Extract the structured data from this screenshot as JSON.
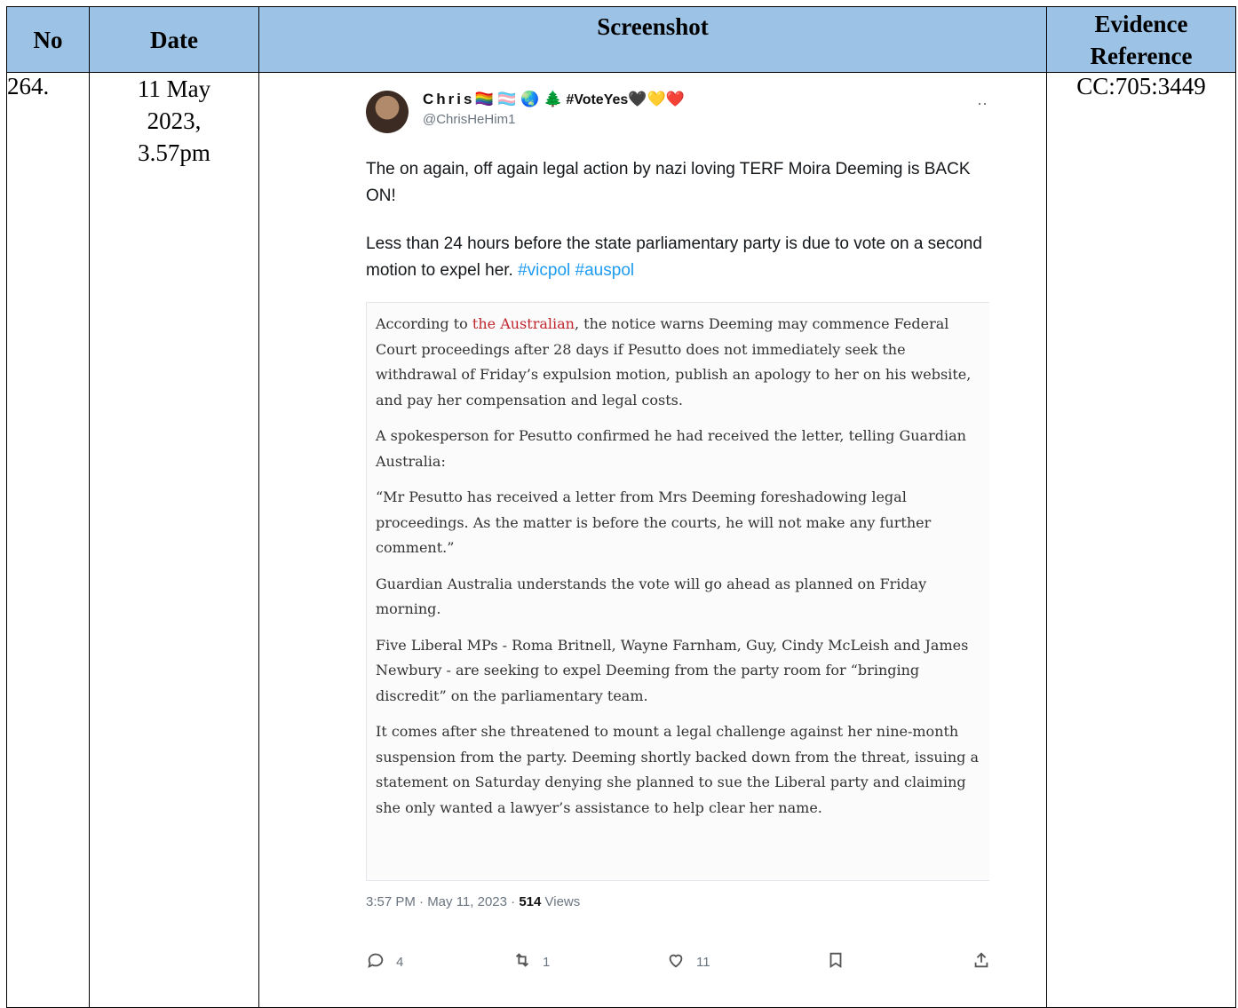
{
  "headers": {
    "no": "No",
    "date": "Date",
    "screenshot": "Screenshot",
    "evidence_reference": "Evidence Reference"
  },
  "row": {
    "no": "264.",
    "date_line1": "11 May",
    "date_line2": "2023,",
    "date_line3": "3.57pm",
    "evidence_reference": "CC:705:3449"
  },
  "tweet": {
    "display_name": "Chris",
    "name_emojis": "🏳️‍🌈 🏳️‍⚧️ 🌏 🌲",
    "name_hashtag": "#VoteYes",
    "name_hearts": "🖤💛❤️",
    "handle": "@ChrisHeHim1",
    "more_icon": "ellipsis-icon",
    "text_p1": "The on again, off again legal action by nazi loving TERF Moira Deeming is BACK ON!",
    "text_p2": "Less than 24 hours before the state parliamentary party is due to vote on a second motion to expel her.",
    "hashtag1": "#vicpol",
    "hashtag2": "#auspol",
    "timestamp": "3:57 PM · May 11, 2023 · ",
    "views_count": "514",
    "views_label": " Views",
    "replies": "4",
    "retweets": "1",
    "likes": "11",
    "accent_color": "#1d9bf0"
  },
  "quote": {
    "p1_before": "According to ",
    "p1_link": "the Australian",
    "p1_after": ", the notice warns Deeming may commence Federal Court proceedings after 28 days if Pesutto does not immediately seek the withdrawal of Friday’s expulsion motion, publish an apology to her on his website, and pay her compensation and legal costs.",
    "p2": "A spokesperson for Pesutto confirmed he had received the letter, telling Guardian Australia:",
    "p3": "“Mr Pesutto has received a letter from Mrs Deeming foreshadowing legal proceedings. As the matter is before the courts, he will not make any further comment.”",
    "p4": "Guardian Australia understands the vote will go ahead as planned on Friday morning.",
    "p5": "Five Liberal MPs - Roma Britnell, Wayne Farnham, Guy, Cindy McLeish and James Newbury - are seeking to expel Deeming from the party room for “bringing discredit” on the parliamentary team.",
    "p6": "It comes after she threatened to mount a legal challenge against her nine-month suspension from the party. Deeming shortly backed down from the threat, issuing a statement on Saturday denying she planned to sue the Liberal party and claiming she only wanted a lawyer’s assistance to help clear her name."
  }
}
